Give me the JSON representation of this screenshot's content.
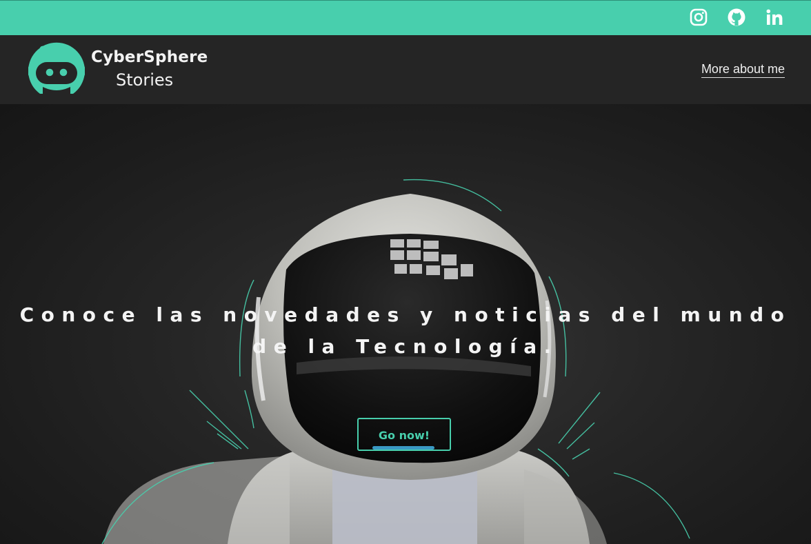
{
  "social": {
    "instagram": "instagram-icon",
    "github": "github-icon",
    "linkedin": "linkedin-icon"
  },
  "brand": {
    "line1": "CyberSphere",
    "line2": "Stories",
    "accent": "#48cfad"
  },
  "nav": {
    "more_about_me": "More about me"
  },
  "hero": {
    "headline": "Conoce las novedades y noticias del mundo de la Tecnología.",
    "cta_label": "Go now!"
  },
  "colors": {
    "accent": "#48cfad",
    "header_bg": "#252525",
    "hero_bg": "#1c1c1c"
  }
}
